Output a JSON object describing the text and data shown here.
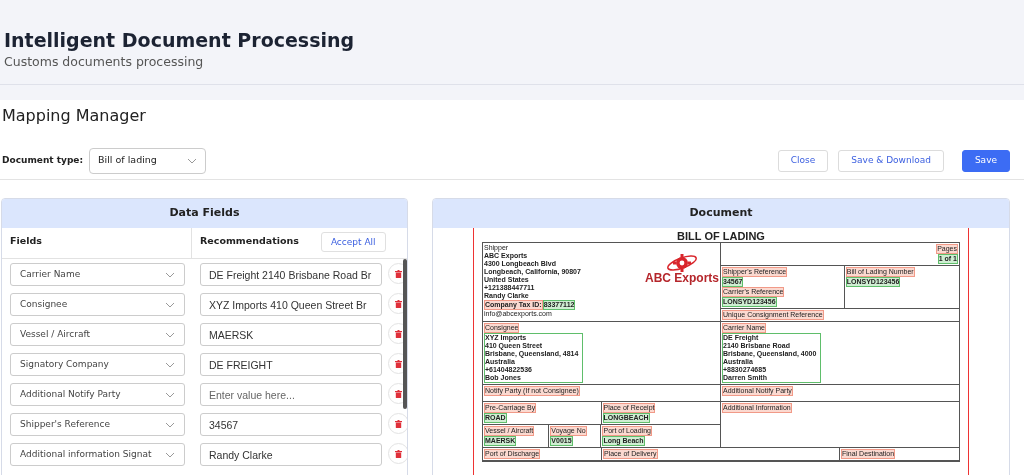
{
  "header": {
    "title": "Intelligent Document Processing",
    "subtitle": "Customs documents processing"
  },
  "page_title": "Mapping Manager",
  "document_type": {
    "label": "Document type:",
    "value": "Bill of lading"
  },
  "buttons": [
    {
      "label": "Close",
      "kind": "outline"
    },
    {
      "label": "Save & Download",
      "kind": "outline"
    },
    {
      "label": "Save",
      "kind": "primary"
    }
  ],
  "data_fields": {
    "title": "Data Fields",
    "columns": [
      "Fields",
      "Recommendations"
    ],
    "accept_all": "Accept All",
    "rows": [
      {
        "field": "Carrier Name",
        "value": "DE Freight 2140 Brisbane Road Br"
      },
      {
        "field": "Consignee",
        "value": "XYZ Imports 410 Queen Street Br"
      },
      {
        "field": "Vessel / Aircraft",
        "value": "MAERSK"
      },
      {
        "field": "Signatory Company",
        "value": "DE FREIGHT"
      },
      {
        "field": "Additional Notify Party",
        "placeholder": "Enter value here..."
      },
      {
        "field": "Shipper's Reference",
        "value": "34567"
      },
      {
        "field": "Additional information Signat",
        "value": "Randy Clarke"
      }
    ]
  },
  "document": {
    "title": "Document",
    "heading": "BILL OF LADING",
    "logo_text": "ABC Exports",
    "shipper": {
      "label": "Shipper",
      "lines": [
        "ABC Exports",
        "4300 Longbeach Blvd",
        "Longbeach, California, 90807",
        "United States",
        "+121388447711",
        "Randy Clarke"
      ],
      "tax_label": "Company Tax ID:",
      "tax_value": "83377112",
      "email": "info@abcexports.com"
    },
    "pages": {
      "label": "Pages",
      "value": "1 of 1"
    },
    "shippers_reference": {
      "label": "Shipper's Reference",
      "value": "34567"
    },
    "carriers_reference": {
      "label": "Carrier's Reference",
      "value": "LONSYD123456"
    },
    "bill_of_lading_number": {
      "label": "Bill of Lading Number",
      "value": "LONSYD123456"
    },
    "unique_consignment_reference": {
      "label": "Unique Consignment Reference"
    },
    "consignee": {
      "label": "Consignee",
      "lines": [
        "XYZ Imports",
        "410 Queen Street",
        "Brisbane, Queensland, 4814",
        "Australia",
        "+61404822536",
        "Bob Jones"
      ]
    },
    "carrier_name": {
      "label": "Carrier Name",
      "lines": [
        "DE Freight",
        "2140 Brisbane Road",
        "Brisbane, Queensland, 4000",
        "Australia",
        "+8830274685",
        "Darren Smith"
      ]
    },
    "notify_party": {
      "label": "Notify Party (If not Consignee)"
    },
    "additional_notify_party": {
      "label": "Additional Notify Party"
    },
    "pre_carriage_by": {
      "label": "Pre-Carriage By",
      "value": "ROAD"
    },
    "place_of_receipt": {
      "label": "Place of Receipt",
      "value": "LONGBEACH"
    },
    "additional_information": {
      "label": "Additional Information"
    },
    "vessel_aircraft": {
      "label": "Vessel / Aircraft",
      "value": "MAERSK"
    },
    "voyage_no": {
      "label": "Voyage No",
      "value": "V0015"
    },
    "port_of_loading": {
      "label": "Port of Loading",
      "value": "Long Beach"
    },
    "port_of_discharge": {
      "label": "Port of Discharge"
    },
    "place_of_delivery": {
      "label": "Place of Delivery"
    },
    "final_destination": {
      "label": "Final Destination"
    }
  }
}
